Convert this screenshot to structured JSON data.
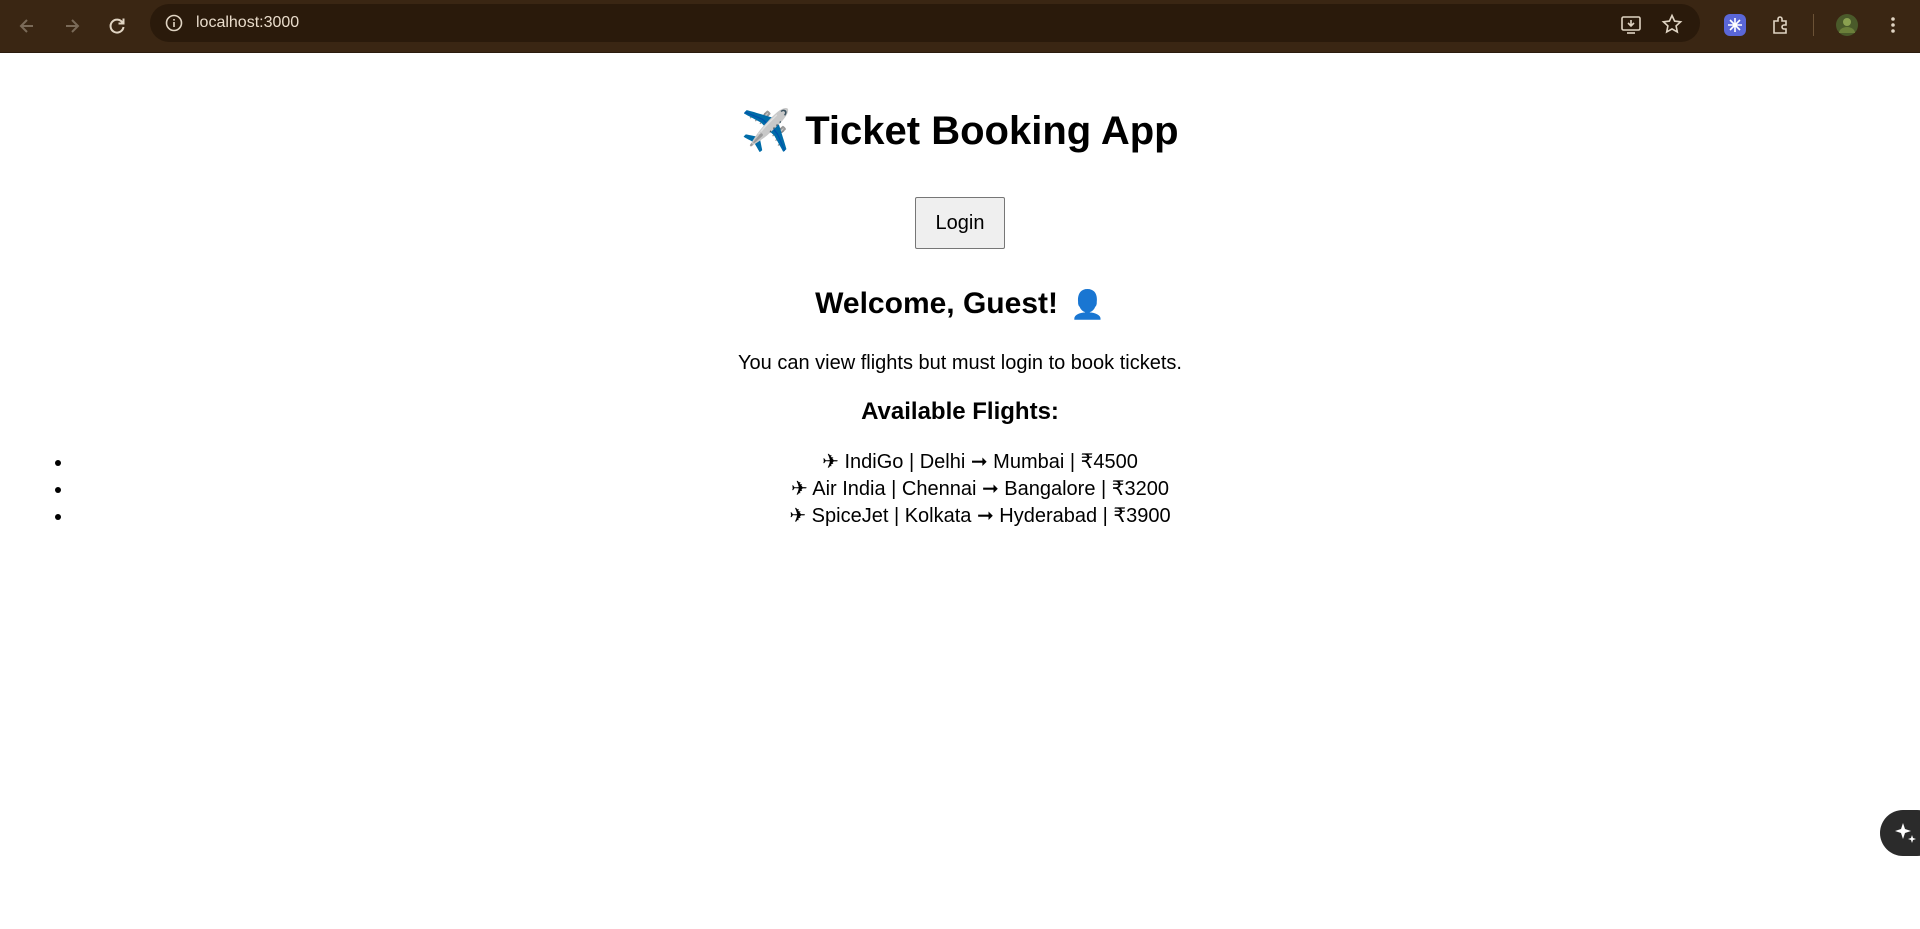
{
  "browser": {
    "url": "localhost:3000",
    "icons": {
      "back": "back-arrow-icon",
      "forward": "forward-arrow-icon",
      "reload": "reload-icon",
      "info": "site-info-icon",
      "install": "install-app-icon",
      "bookmark": "star-icon",
      "extension_active": "extension-icon",
      "extensions": "puzzle-icon",
      "profile": "avatar",
      "menu": "kebab-menu-icon"
    },
    "colors": {
      "toolbar": "#3a2613",
      "omnibox": "#2a1a0b",
      "extension_accent": "#5a67d8"
    }
  },
  "page": {
    "title": "Ticket Booking App",
    "title_icon": "✈️",
    "login_label": "Login",
    "welcome": "Welcome, Guest!",
    "welcome_icon": "👤",
    "info_text": "You can view flights but must login to book tickets.",
    "flights_heading": "Available Flights:",
    "flights": [
      {
        "text": "✈ IndiGo | Delhi ➞ Mumbai | ₹4500"
      },
      {
        "text": "✈ Air India | Chennai ➞ Bangalore | ₹3200"
      },
      {
        "text": "✈ SpiceJet | Kolkata ➞ Hyderabad | ₹3900"
      }
    ]
  },
  "floating_action": {
    "icon": "sparkle-icon"
  }
}
